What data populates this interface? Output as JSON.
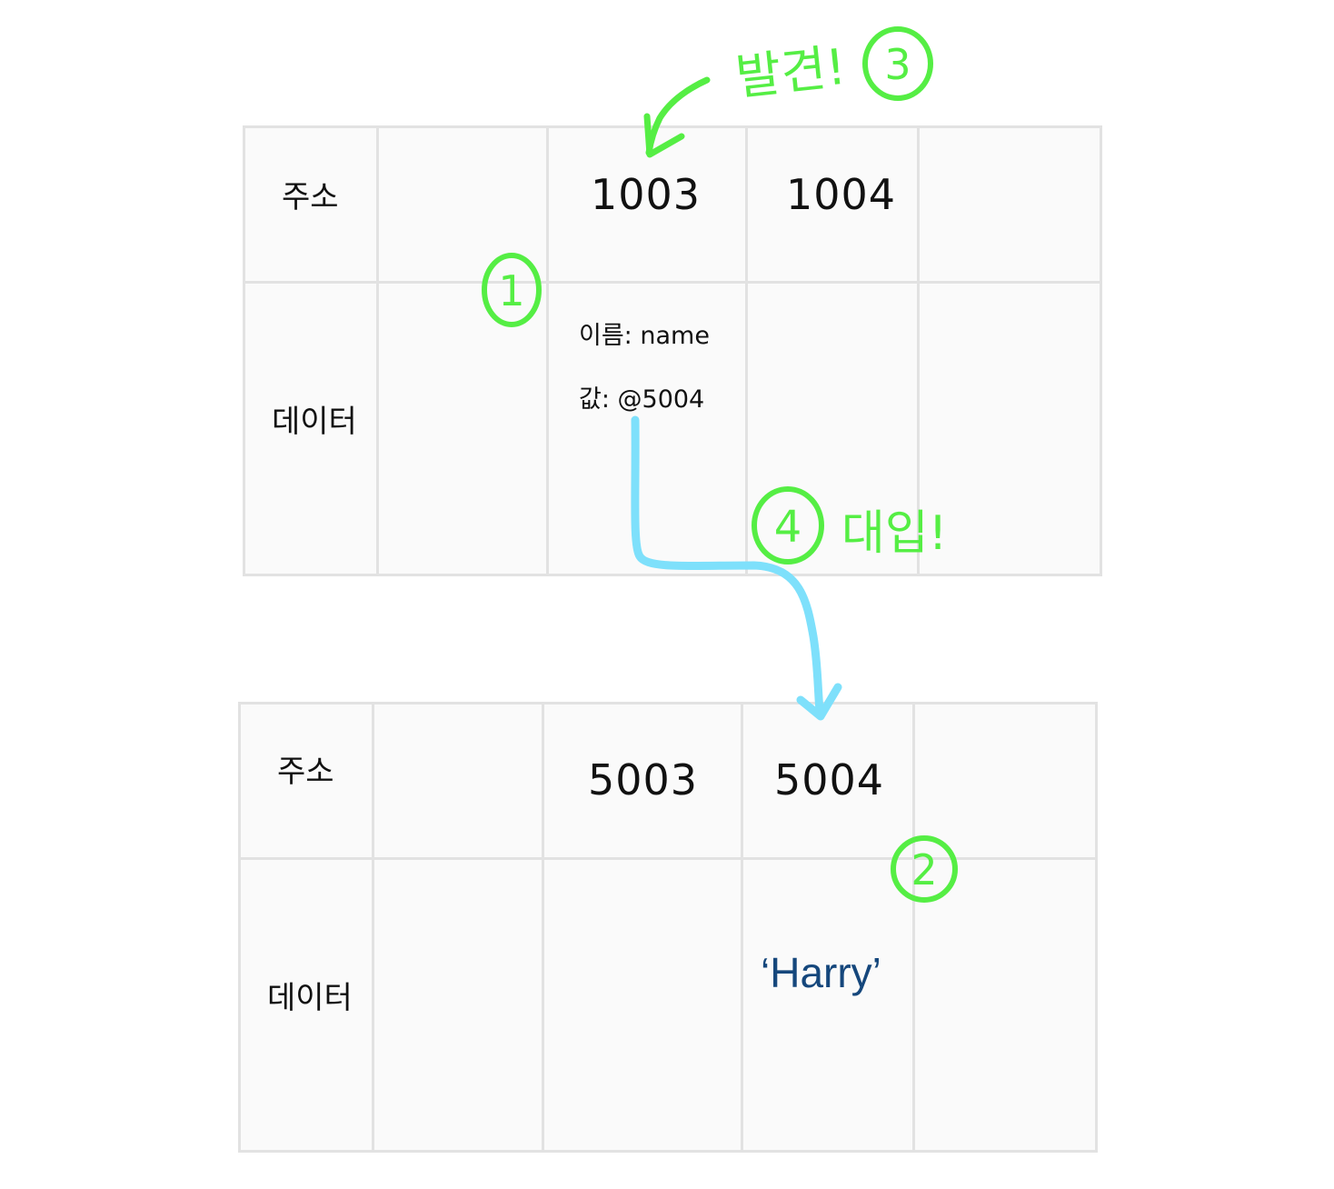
{
  "top_table": {
    "address_label": "주소",
    "data_label": "데이터",
    "addresses": [
      "",
      "1003",
      "1004",
      ""
    ],
    "cell_1003": {
      "name_line": "이름: name",
      "value_line": "값: @5004"
    }
  },
  "bottom_table": {
    "address_label": "주소",
    "data_label": "데이터",
    "addresses": [
      "",
      "5003",
      "5004",
      ""
    ],
    "cell_5004": {
      "value": "‘Harry’"
    }
  },
  "annotations": {
    "step_1": "1",
    "step_2": "2",
    "step_3": "3",
    "step_4": "4",
    "found_text": "발견!",
    "assign_text": "대입!"
  },
  "colors": {
    "annotation_green": "#55ee44",
    "arrow_blue": "#7ee0fb",
    "value_blue": "#15477c",
    "grid": "#e2e2e2",
    "cell_bg": "#fafafa"
  }
}
